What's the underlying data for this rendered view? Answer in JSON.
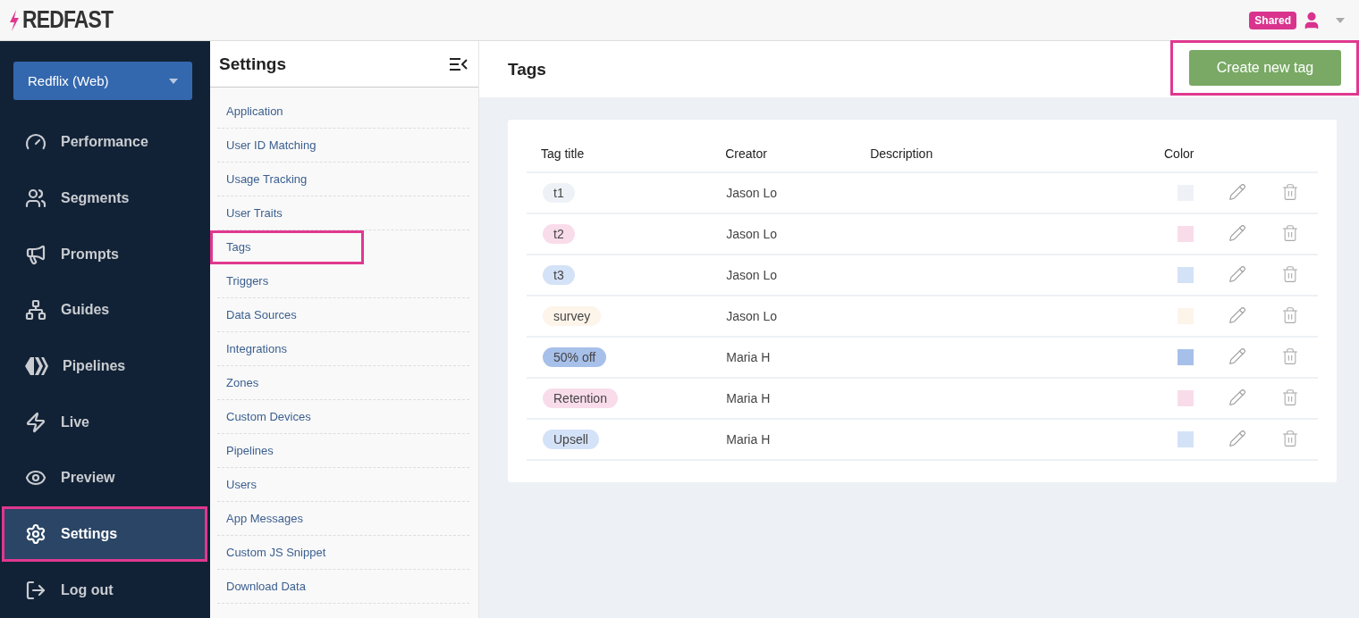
{
  "header": {
    "logo": "REDFAST",
    "badge": "Shared"
  },
  "app_selector": {
    "value": "Redflix (Web)"
  },
  "nav": [
    {
      "kind": "performance",
      "label": "Performance",
      "selected": false,
      "highlighted": false
    },
    {
      "kind": "segments",
      "label": "Segments",
      "selected": false,
      "highlighted": false
    },
    {
      "kind": "prompts",
      "label": "Prompts",
      "selected": false,
      "highlighted": false
    },
    {
      "kind": "guides",
      "label": "Guides",
      "selected": false,
      "highlighted": false
    },
    {
      "kind": "pipelines",
      "label": "Pipelines",
      "selected": false,
      "highlighted": false
    },
    {
      "kind": "live",
      "label": "Live",
      "selected": false,
      "highlighted": false
    },
    {
      "kind": "preview",
      "label": "Preview",
      "selected": false,
      "highlighted": false
    },
    {
      "kind": "settings",
      "label": "Settings",
      "selected": true,
      "highlighted": true
    },
    {
      "kind": "logout",
      "label": "Log out",
      "selected": false,
      "highlighted": false
    }
  ],
  "settings_menu": {
    "title": "Settings",
    "items": [
      {
        "label": "Application",
        "highlighted": false
      },
      {
        "label": "User ID Matching",
        "highlighted": false
      },
      {
        "label": "Usage Tracking",
        "highlighted": false
      },
      {
        "label": "User Traits",
        "highlighted": false
      },
      {
        "label": "Tags",
        "highlighted": true
      },
      {
        "label": "Triggers",
        "highlighted": false
      },
      {
        "label": "Data Sources",
        "highlighted": false
      },
      {
        "label": "Integrations",
        "highlighted": false
      },
      {
        "label": "Zones",
        "highlighted": false
      },
      {
        "label": "Custom Devices",
        "highlighted": false
      },
      {
        "label": "Pipelines",
        "highlighted": false
      },
      {
        "label": "Users",
        "highlighted": false
      },
      {
        "label": "App Messages",
        "highlighted": false
      },
      {
        "label": "Custom JS Snippet",
        "highlighted": false
      },
      {
        "label": "Download Data",
        "highlighted": false
      }
    ]
  },
  "page": {
    "title": "Tags",
    "create_button": {
      "label": "Create new tag",
      "highlighted": true
    }
  },
  "table": {
    "columns": [
      "Tag title",
      "Creator",
      "Description",
      "Color"
    ],
    "rows": [
      {
        "title": "t1",
        "creator": "Jason Lo",
        "color": "#eef2f7"
      },
      {
        "title": "t2",
        "creator": "Jason Lo",
        "color": "#f9dcea"
      },
      {
        "title": "t3",
        "creator": "Jason Lo",
        "color": "#d4e2f7"
      },
      {
        "title": "survey",
        "creator": "Jason Lo",
        "color": "#fdf4ea"
      },
      {
        "title": "50% off",
        "creator": "Maria H",
        "color": "#a7c0ea"
      },
      {
        "title": "Retention",
        "creator": "Maria H",
        "color": "#f9dcea"
      },
      {
        "title": "Upsell",
        "creator": "Maria H",
        "color": "#d4e2f7"
      }
    ]
  }
}
